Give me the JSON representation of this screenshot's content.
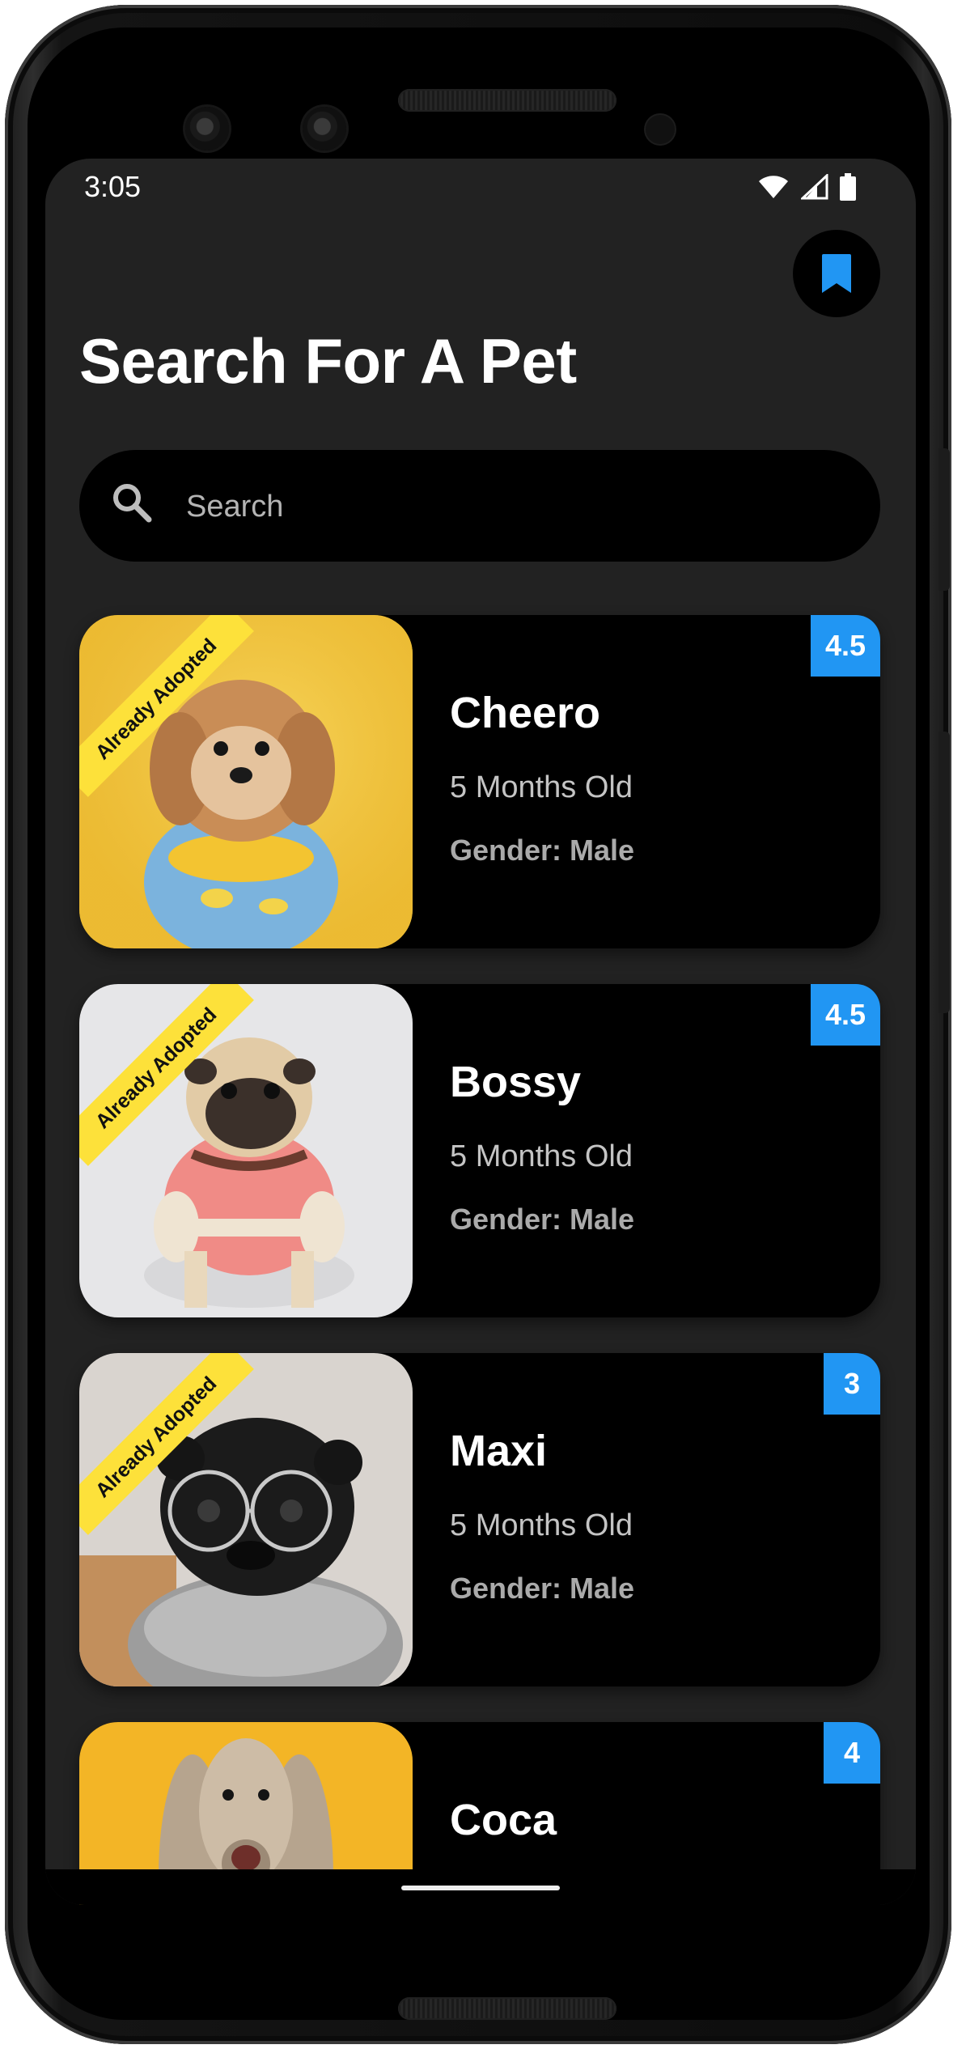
{
  "status_bar": {
    "time": "3:05",
    "icons": [
      "wifi-icon",
      "signal-icon",
      "battery-icon"
    ]
  },
  "header": {
    "title": "Search For A Pet",
    "bookmark_icon": "bookmark-icon"
  },
  "search": {
    "placeholder": "Search",
    "value": "",
    "icon": "search-icon"
  },
  "pets": [
    {
      "name": "Cheero",
      "age": "5 Months Old",
      "gender": "Gender: Male",
      "rating": "4.5",
      "ribbon": "Already Adopted",
      "photo": "small-fluffy-dog-in-banana-pajamas"
    },
    {
      "name": "Bossy",
      "age": "5 Months Old",
      "gender": "Gender: Male",
      "rating": "4.5",
      "ribbon": "Already Adopted",
      "photo": "pug-in-pink-shirt"
    },
    {
      "name": "Maxi",
      "age": "5 Months Old",
      "gender": "Gender: Male",
      "rating": "3",
      "ribbon": "Already Adopted",
      "photo": "black-pug-with-glasses"
    },
    {
      "name": "Coca",
      "age": "",
      "gender": "",
      "rating": "4",
      "ribbon": "",
      "photo": "afghan-hound"
    }
  ],
  "colors": {
    "background": "#222222",
    "card": "#000000",
    "accent": "#2196f3",
    "ribbon": "#fde13a"
  }
}
